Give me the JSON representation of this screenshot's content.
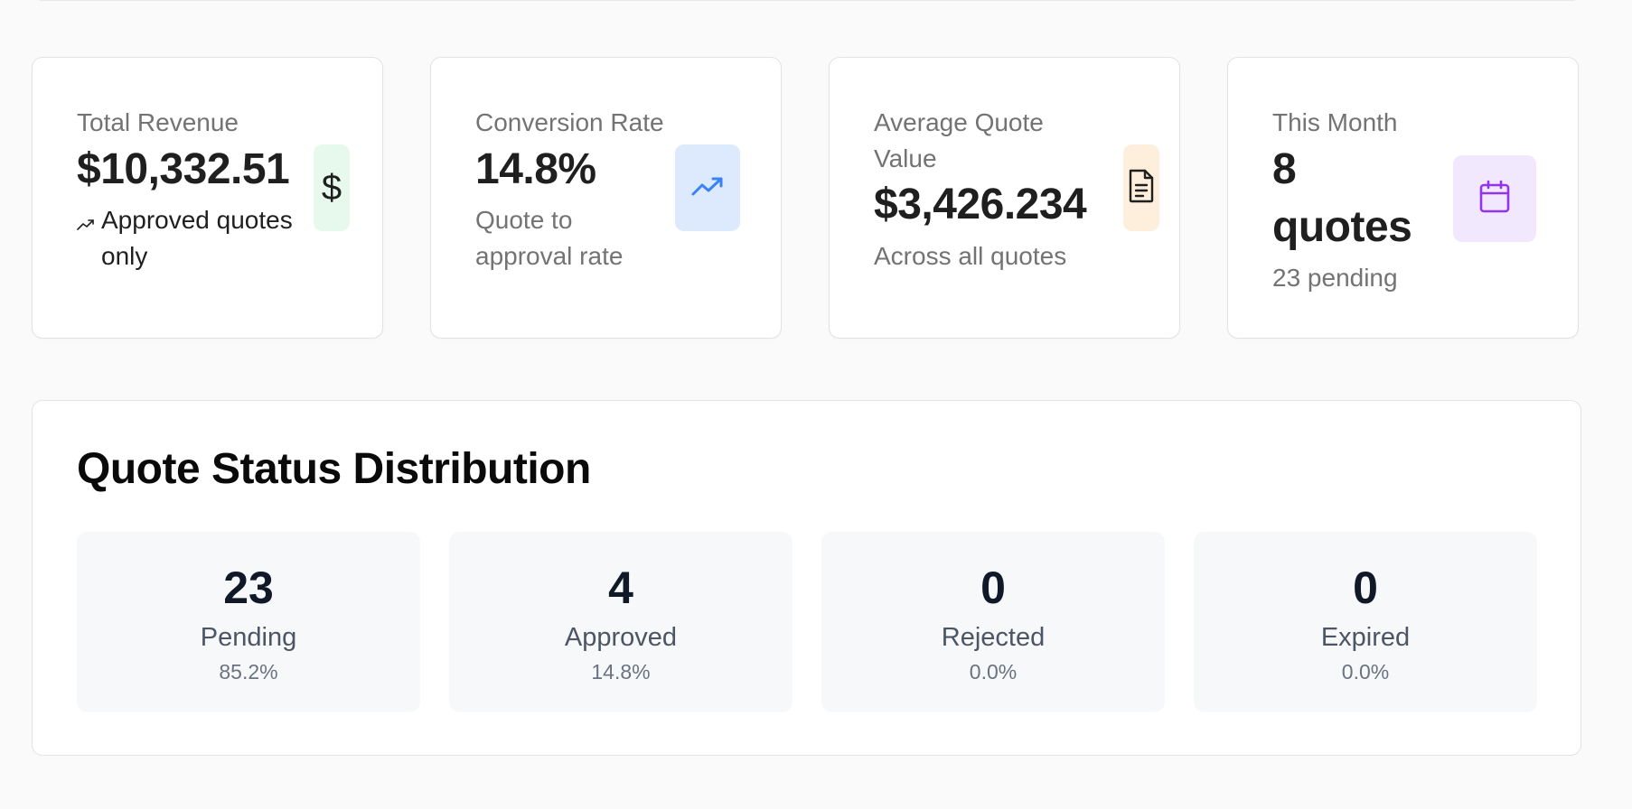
{
  "kpis": [
    {
      "title": "Total Revenue",
      "value": "$10,332.51",
      "subtitle": "Approved quotes only",
      "icon": "dollar-icon",
      "icon_bg": "#e7f8ec",
      "icon_color": "#1f1f1f"
    },
    {
      "title": "Conversion Rate",
      "value": "14.8%",
      "subtitle": "Quote to approval rate",
      "icon": "trending-up-icon",
      "icon_bg": "#dde9fc",
      "icon_color": "#3b82f6"
    },
    {
      "title": "Average Quote Value",
      "value": "$3,426.234",
      "subtitle": "Across all quotes",
      "icon": "document-icon",
      "icon_bg": "#fdefdc",
      "icon_color": "#1f1f1f"
    },
    {
      "title": "This Month",
      "value": "8 quotes",
      "subtitle": "23 pending",
      "icon": "calendar-icon",
      "icon_bg": "#f1e8fd",
      "icon_color": "#9333ea"
    }
  ],
  "distribution": {
    "title": "Quote Status Distribution",
    "statuses": [
      {
        "count": "23",
        "label": "Pending",
        "percent": "85.2%"
      },
      {
        "count": "4",
        "label": "Approved",
        "percent": "14.8%"
      },
      {
        "count": "0",
        "label": "Rejected",
        "percent": "0.0%"
      },
      {
        "count": "0",
        "label": "Expired",
        "percent": "0.0%"
      }
    ]
  }
}
